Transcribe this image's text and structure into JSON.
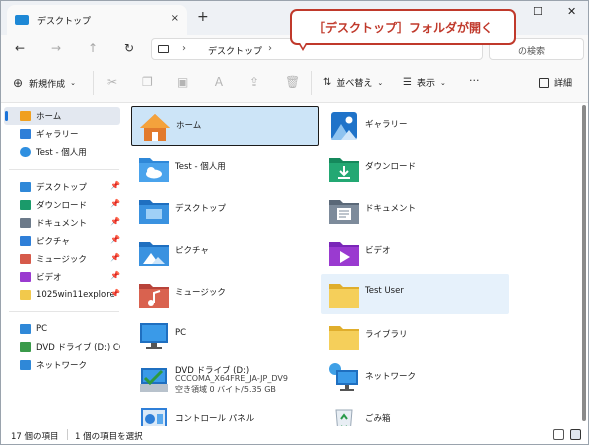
{
  "window": {
    "tab_title": "デスクトップ",
    "tab_close": "×",
    "new_tab": "+",
    "minimize": "—",
    "maximize": "☐",
    "close": "✕"
  },
  "addressbar": {
    "back": "←",
    "forward": "→",
    "up": "↑",
    "refresh": "↻",
    "separator": "›",
    "crumb": "デスクトップ",
    "search_text": "の検索"
  },
  "callout": "［デスクトップ］フォルダが開く",
  "toolbar": {
    "new_label": "新規作成",
    "sort_label": "並べ替え",
    "view_label": "表示",
    "more_label": "···",
    "details_label": "詳細"
  },
  "sidebar": {
    "items": [
      {
        "label": "ホーム",
        "color": "#f0a020",
        "pinned": false
      },
      {
        "label": "ギャラリー",
        "color": "#2f7fd8",
        "pinned": false
      },
      {
        "label": "Test - 個人用",
        "color": "#2f8fe0",
        "pinned": false
      },
      {
        "label": "デスクトップ",
        "color": "#2f88d8",
        "pinned": true
      },
      {
        "label": "ダウンロード",
        "color": "#1a9a6a",
        "pinned": true
      },
      {
        "label": "ドキュメント",
        "color": "#6c7a8a",
        "pinned": true
      },
      {
        "label": "ピクチャ",
        "color": "#2f7fd8",
        "pinned": true
      },
      {
        "label": "ミュージック",
        "color": "#d65a4a",
        "pinned": true
      },
      {
        "label": "ビデオ",
        "color": "#9a3ad0",
        "pinned": true
      },
      {
        "label": "1025win11explore",
        "color": "#f2c94c",
        "pinned": true
      },
      {
        "label": "PC",
        "color": "#2f88d8",
        "pinned": false
      },
      {
        "label": "DVD ドライブ (D:) CCCC",
        "color": "#3a9a4a",
        "pinned": false
      },
      {
        "label": "ネットワーク",
        "color": "#2f88d8",
        "pinned": false
      }
    ],
    "pin_glyph": "📌"
  },
  "content": {
    "items": [
      {
        "name": "ホーム",
        "icon": "home-icon"
      },
      {
        "name": "ギャラリー",
        "icon": "gallery-icon"
      },
      {
        "name": "Test - 個人用",
        "icon": "onedrive-folder-icon"
      },
      {
        "name": "ダウンロード",
        "icon": "downloads-folder-icon"
      },
      {
        "name": "デスクトップ",
        "icon": "desktop-folder-icon"
      },
      {
        "name": "ドキュメント",
        "icon": "documents-folder-icon"
      },
      {
        "name": "ピクチャ",
        "icon": "pictures-folder-icon"
      },
      {
        "name": "ビデオ",
        "icon": "videos-folder-icon"
      },
      {
        "name": "ミュージック",
        "icon": "music-folder-icon"
      },
      {
        "name": "Test User",
        "icon": "user-folder-icon"
      },
      {
        "name": "PC",
        "icon": "pc-icon"
      },
      {
        "name": "ライブラリ",
        "icon": "libraries-folder-icon"
      },
      {
        "name": "DVD ドライブ (D:)",
        "sub1": "CCCOMA_X64FRE_JA-JP_DV9",
        "sub2": "空き領域 0 バイト/5.35 GB",
        "icon": "dvd-drive-icon"
      },
      {
        "name": "ネットワーク",
        "icon": "network-icon"
      },
      {
        "name": "コントロール パネル",
        "icon": "control-panel-icon"
      },
      {
        "name": "ごみ箱",
        "icon": "recycle-bin-icon"
      }
    ]
  },
  "statusbar": {
    "count": "17 個の項目",
    "selection": "1 個の項目を選択"
  },
  "colors": {
    "accent": "#1a73d9",
    "callout": "#c0392b",
    "selection": "#cce4f7",
    "folder": "#f2c94c",
    "folder_blue": "#2f88d8"
  }
}
